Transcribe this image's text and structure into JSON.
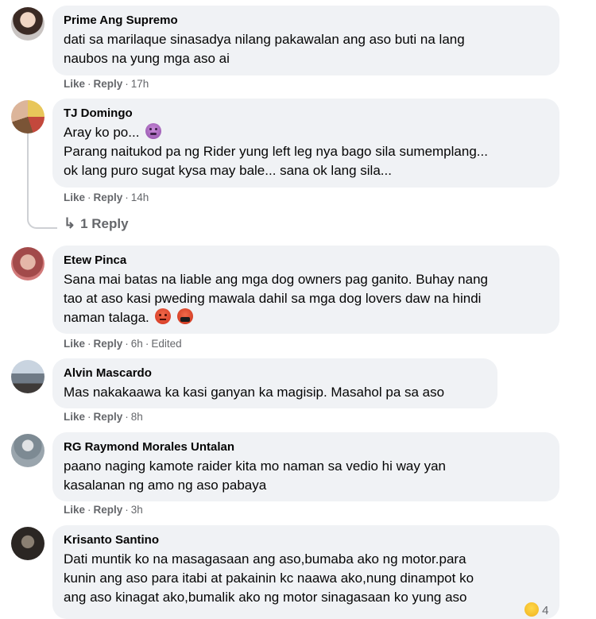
{
  "comments": [
    {
      "name": "Prime Ang Supremo",
      "lines": [
        "dati sa marilaque sinasadya nilang pakawalan ang aso buti na lang",
        "naubos na yung mga aso ai"
      ],
      "like": "Like",
      "reply": "Reply",
      "time": "17h"
    },
    {
      "name": "TJ Domingo",
      "lines": [
        "Aray ko po...",
        "Parang naitukod pa ng Rider yung left leg nya bago sila sumemplang...",
        "ok lang puro sugat kysa may bale... sana ok lang sila..."
      ],
      "emoji": "nauseated-face",
      "like": "Like",
      "reply": "Reply",
      "time": "14h",
      "replies_label": "1 Reply"
    },
    {
      "name": "Etew Pinca",
      "lines": [
        "Sana mai batas na liable ang mga dog owners pag ganito. Buhay nang",
        "tao at aso kasi pweding mawala dahil sa mga dog lovers daw na hindi",
        "naman talaga."
      ],
      "emoji": [
        "angry-face",
        "cursing-face"
      ],
      "like": "Like",
      "reply": "Reply",
      "time": "6h",
      "edited": "Edited"
    },
    {
      "name": "Alvin Mascardo",
      "lines": [
        "Mas nakakaawa ka kasi ganyan ka magisip. Masahol pa sa aso"
      ],
      "like": "Like",
      "reply": "Reply",
      "time": "8h"
    },
    {
      "name": "RG Raymond Morales Untalan",
      "lines": [
        "paano naging kamote raider kita mo naman sa vedio hi way yan",
        "kasalanan ng amo ng aso pabaya"
      ],
      "like": "Like",
      "reply": "Reply",
      "time": "3h"
    },
    {
      "name": "Krisanto Santino",
      "lines": [
        "Dati muntik ko na masagasaan ang aso,bumaba ako ng motor.para",
        "kunin ang aso para itabi at pakainin kc naawa ako,nung dinampot ko",
        "ang aso kinagat ako,bumalik ako ng motor sinagasaan ko yung aso"
      ],
      "reaction_count": "4"
    }
  ],
  "colors": {
    "bubble": "#f0f2f5",
    "meta": "#65676b",
    "text": "#050505"
  }
}
